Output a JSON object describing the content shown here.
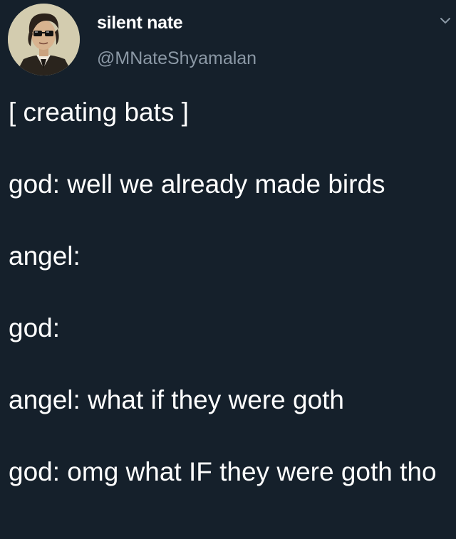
{
  "tweet": {
    "author": {
      "display_name": "silent nate",
      "handle": "@MNateShyamalan",
      "avatar_icon": "portrait-avatar",
      "menu_icon": "chevron-down-icon"
    },
    "lines": [
      "[ creating bats ]",
      "god: well we already made birds",
      "angel:",
      "god:",
      "angel: what if they were goth",
      "god: omg what IF they were goth tho"
    ]
  },
  "colors": {
    "background": "#15202b",
    "text_primary": "#ffffff",
    "text_secondary": "#8b98a5"
  }
}
